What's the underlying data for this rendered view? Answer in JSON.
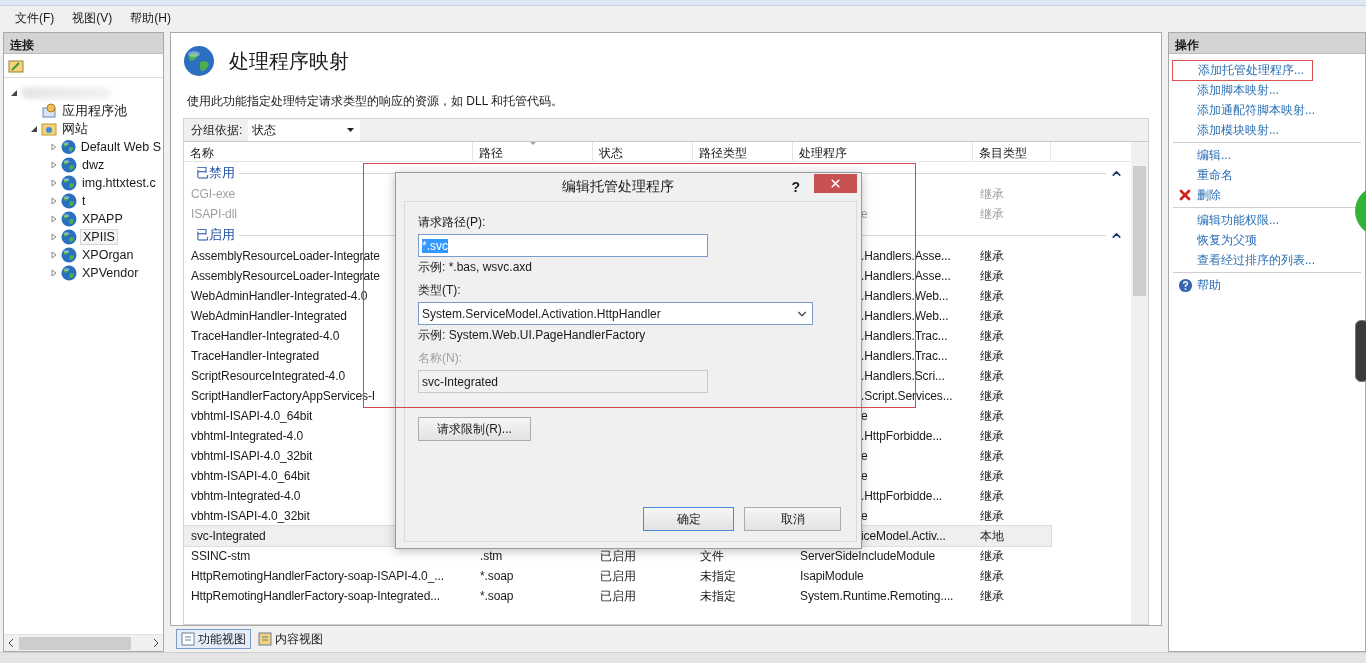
{
  "menu": [
    "文件(F)",
    "视图(V)",
    "帮助(H)"
  ],
  "connections": {
    "title": "连接",
    "tree": [
      {
        "kind": "server",
        "expanded": true,
        "children": [
          {
            "kind": "pool",
            "label": "应用程序池",
            "selected": false
          },
          {
            "kind": "sites",
            "label": "网站",
            "expanded": true,
            "selected": false,
            "children": [
              {
                "kind": "site",
                "label": "Default Web S",
                "expanded": false,
                "selected": false
              },
              {
                "kind": "site",
                "label": "dwz",
                "expanded": false,
                "selected": false
              },
              {
                "kind": "site",
                "label": "img.httxtest.c",
                "expanded": false,
                "selected": false
              },
              {
                "kind": "site",
                "label": "t",
                "expanded": false,
                "selected": false
              },
              {
                "kind": "site",
                "label": "XPAPP",
                "expanded": false,
                "selected": false
              },
              {
                "kind": "site",
                "label": "XPIIS",
                "expanded": false,
                "selected": true
              },
              {
                "kind": "site",
                "label": "XPOrgan",
                "expanded": false,
                "selected": false
              },
              {
                "kind": "site",
                "label": "XPVendor",
                "expanded": false,
                "selected": false
              }
            ]
          }
        ]
      }
    ]
  },
  "feature": {
    "title": "处理程序映射",
    "description": "使用此功能指定处理特定请求类型的响应的资源，如 DLL 和托管代码。",
    "group_by": {
      "label": "分组依据:",
      "value": "状态"
    },
    "columns": [
      "名称",
      "路径",
      "状态",
      "路径类型",
      "处理程序",
      "条目类型"
    ],
    "groups": [
      {
        "label": "已禁用",
        "disabled": true,
        "expanded": true,
        "rows": [
          {
            "name": "CGI-exe",
            "entry_type": "继承",
            "selected": false
          },
          {
            "name": "ISAPI-dll",
            "handler": "e",
            "entry_type": "继承",
            "covered": true,
            "selected": false
          }
        ]
      },
      {
        "label": "已启用",
        "disabled": false,
        "expanded": true,
        "rows": [
          {
            "name": "AssemblyResourceLoader-Integrate",
            "handler": ".Handlers.Asse...",
            "entry_type": "继承",
            "covered": true,
            "selected": false
          },
          {
            "name": "AssemblyResourceLoader-Integrate",
            "handler": ".Handlers.Asse...",
            "entry_type": "继承",
            "covered": true,
            "selected": false
          },
          {
            "name": "WebAdminHandler-Integrated-4.0",
            "handler": ".Handlers.Web...",
            "entry_type": "继承",
            "covered": true,
            "selected": false
          },
          {
            "name": "WebAdminHandler-Integrated",
            "handler": ".Handlers.Web...",
            "entry_type": "继承",
            "covered": true,
            "selected": false
          },
          {
            "name": "TraceHandler-Integrated-4.0",
            "handler": ".Handlers.Trac...",
            "entry_type": "继承",
            "covered": true,
            "selected": false
          },
          {
            "name": "TraceHandler-Integrated",
            "handler": ".Handlers.Trac...",
            "entry_type": "继承",
            "covered": true,
            "selected": false
          },
          {
            "name": "ScriptResourceIntegrated-4.0",
            "handler": ".Handlers.Scri...",
            "entry_type": "继承",
            "covered": true,
            "selected": false
          },
          {
            "name": "ScriptHandlerFactoryAppServices-I",
            "handler": ".Script.Services...",
            "entry_type": "继承",
            "covered": true,
            "selected": false
          },
          {
            "name": "vbhtml-ISAPI-4.0_64bit",
            "handler": "e",
            "entry_type": "继承",
            "covered": true,
            "selected": false
          },
          {
            "name": "vbhtml-Integrated-4.0",
            "handler": ".HttpForbidde...",
            "entry_type": "继承",
            "covered": true,
            "selected": false
          },
          {
            "name": "vbhtml-ISAPI-4.0_32bit",
            "handler": "e",
            "entry_type": "继承",
            "covered": true,
            "selected": false
          },
          {
            "name": "vbhtm-ISAPI-4.0_64bit",
            "handler": "e",
            "entry_type": "继承",
            "covered": true,
            "selected": false
          },
          {
            "name": "vbhtm-Integrated-4.0",
            "handler": ".HttpForbidde...",
            "entry_type": "继承",
            "covered": true,
            "selected": false
          },
          {
            "name": "vbhtm-ISAPI-4.0_32bit",
            "handler": "e",
            "entry_type": "继承",
            "covered": true,
            "selected": false
          },
          {
            "name": "svc-Integrated",
            "handler": "iceModel.Activ...",
            "entry_type": "本地",
            "covered": true,
            "selected": true
          },
          {
            "name": "SSINC-stm",
            "path": ".stm",
            "status": "已启用",
            "path_type": "文件",
            "handler": "ServerSideIncludeModule",
            "entry_type": "继承",
            "covered": false,
            "selected": false
          },
          {
            "name": "HttpRemotingHandlerFactory-soap-ISAPI-4.0_...",
            "path": "*.soap",
            "status": "已启用",
            "path_type": "未指定",
            "handler": "IsapiModule",
            "entry_type": "继承",
            "covered": false,
            "selected": false
          },
          {
            "name": "HttpRemotingHandlerFactory-soap-Integrated...",
            "path": "*.soap",
            "status": "已启用",
            "path_type": "未指定",
            "handler": "System.Runtime.Remoting....",
            "entry_type": "继承",
            "covered": false,
            "selected": false
          }
        ]
      }
    ]
  },
  "view_tabs": [
    {
      "label": "功能视图",
      "selected": true
    },
    {
      "label": "内容视图",
      "selected": false
    }
  ],
  "actions": {
    "title": "操作",
    "groups": [
      [
        {
          "kind": "link",
          "label": "添加托管处理程序...",
          "highlighted": true
        },
        {
          "kind": "link",
          "label": "添加脚本映射...",
          "highlighted": false
        },
        {
          "kind": "link",
          "label": "添加通配符脚本映射...",
          "highlighted": false
        },
        {
          "kind": "link",
          "label": "添加模块映射...",
          "highlighted": false
        }
      ],
      [
        {
          "kind": "link",
          "label": "编辑...",
          "highlighted": false
        },
        {
          "kind": "link",
          "label": "重命名",
          "highlighted": false
        },
        {
          "kind": "delete",
          "label": "删除",
          "highlighted": false
        }
      ],
      [
        {
          "kind": "link",
          "label": "编辑功能权限...",
          "highlighted": false
        },
        {
          "kind": "link",
          "label": "恢复为父项",
          "highlighted": false
        },
        {
          "kind": "link",
          "label": "查看经过排序的列表...",
          "highlighted": false
        }
      ],
      [
        {
          "kind": "help",
          "label": "帮助",
          "highlighted": false
        }
      ]
    ]
  },
  "dialog": {
    "title": "编辑托管处理程序",
    "help": "?",
    "fields": [
      {
        "kind": "text",
        "label": "请求路径(P):",
        "value": "*.svc",
        "text_selected": true,
        "disabled": false,
        "hint": "示例: *.bas, wsvc.axd"
      },
      {
        "kind": "select",
        "label": "类型(T):",
        "value": "System.ServiceModel.Activation.HttpHandler",
        "text_selected": false,
        "disabled": false,
        "hint": "示例: System.Web.UI.PageHandlerFactory"
      },
      {
        "kind": "text",
        "label": "名称(N):",
        "value": "svc-Integrated",
        "text_selected": false,
        "disabled": true
      }
    ],
    "limits_button": "请求限制(R)...",
    "buttons": [
      {
        "label": "确定",
        "default": true
      },
      {
        "label": "取消",
        "default": false
      }
    ]
  }
}
